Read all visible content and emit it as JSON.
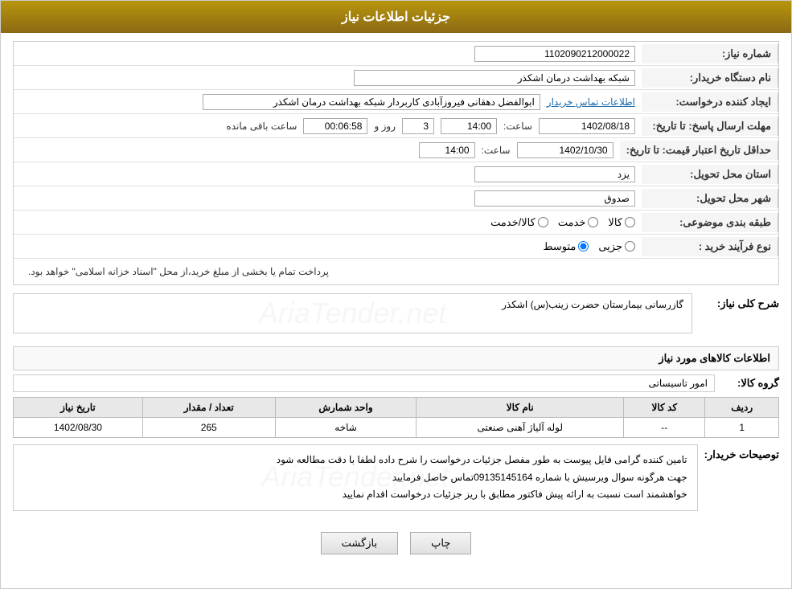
{
  "header": {
    "title": "جزئیات اطلاعات نیاز"
  },
  "fields": {
    "shomara_niaz_label": "شماره نیاز:",
    "shomara_niaz_value": "1102090212000022",
    "name_dastgah_label": "نام دستگاه خریدار:",
    "name_dastgah_value": "شبکه بهداشت درمان اشکذر",
    "ijad_label": "ایجاد کننده درخواست:",
    "ijad_value": "ابوالفضل دهقانی فیروزآبادی کاربردار شبکه بهداشت درمان اشکذر",
    "ijad_link": "اطلاعات تماس خریدار",
    "mohlat_ersal_label": "مهلت ارسال پاسخ: تا تاریخ:",
    "mohlat_date": "1402/08/18",
    "mohlat_time_label": "ساعت:",
    "mohlat_time": "14:00",
    "mohlat_roz_label": "روز و",
    "mohlat_roz": "3",
    "mohlat_remain_label": "ساعت باقی مانده",
    "mohlat_remain": "00:06:58",
    "hadaqal_label": "حداقل تاریخ اعتبار قیمت: تا تاریخ:",
    "hadaqal_date": "1402/10/30",
    "hadaqal_time_label": "ساعت:",
    "hadaqal_time": "14:00",
    "ostan_label": "استان محل تحویل:",
    "ostan_value": "یزد",
    "shahr_label": "شهر محل تحویل:",
    "shahr_value": "صدوق",
    "tabaghe_label": "طبقه بندی موضوعی:",
    "tabaghe_kala": "کالا",
    "tabaghe_khadamat": "خدمت",
    "tabaghe_kala_khadamat": "کالا/خدمت",
    "nooe_farayand_label": "نوع فرآیند خرید :",
    "nooe_jozi": "جزیی",
    "nooe_motovaset": "متوسط",
    "process_note": "پرداخت تمام یا بخشی از مبلغ خرید،از محل \"اسناد خزانه اسلامی\" خواهد بود.",
    "sharh_koli_label": "شرح کلی نیاز:",
    "sharh_koli_value": "گازرسانی بیمارستان حضرت زینب(س) اشکذر",
    "kala_section_title": "اطلاعات کالاهای مورد نیاز",
    "gorouh_kala_label": "گروه کالا:",
    "gorouh_kala_value": "امور تاسیساتی",
    "table": {
      "headers": [
        "ردیف",
        "کد کالا",
        "نام کالا",
        "واحد شمارش",
        "تعداد / مقدار",
        "تاریخ نیاز"
      ],
      "rows": [
        {
          "radif": "1",
          "kod_kala": "--",
          "name_kala": "لوله آلیاژ آهنی صنعتی",
          "vahed": "شاخه",
          "tedad": "265",
          "tarikh": "1402/08/30"
        }
      ]
    },
    "buyer_notes_label": "توصیحات خریدار:",
    "buyer_notes": "تامین کننده گرامی فایل پیوست به طور مفصل جزئیات درخواست را شرح داده لطفا با دقت مطالعه شود\nجهت هرگونه سوال ویرسیش با شماره 09135145164تماس حاصل فرمایید\nخواهشمند است نسبت به ارائه پیش فاکتور مطابق با ریز جزئیات درخواست اقدام نمایید"
  },
  "buttons": {
    "print_label": "چاپ",
    "back_label": "بازگشت"
  }
}
